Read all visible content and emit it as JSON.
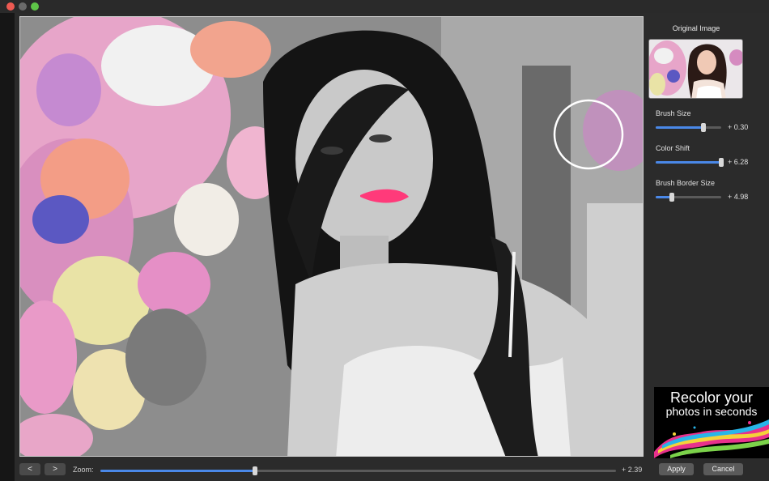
{
  "window": {
    "traffic_lights": [
      "close",
      "minimize",
      "zoom"
    ],
    "colors": {
      "close": "#ee5a52",
      "minimize": "#6b6b6b",
      "zoom": "#5ec548"
    }
  },
  "canvas": {
    "image_description_icon": "photo-canvas",
    "brush_cursor_icon": "circle-brush-cursor"
  },
  "panel": {
    "title": "Original Image",
    "sliders": [
      {
        "label": "Brush Size",
        "value": "+ 0.30",
        "level": 0.73
      },
      {
        "label": "Color Shift",
        "value": "+ 6.28",
        "level": 1.0
      },
      {
        "label": "Brush Border Size",
        "value": "+ 4.98",
        "level": 0.25
      }
    ]
  },
  "bottom": {
    "prev_label": "<",
    "next_label": ">",
    "zoom_label": "Zoom:",
    "zoom_value": "+ 2.39",
    "zoom_level": 0.3,
    "apply_label": "Apply",
    "cancel_label": "Cancel"
  },
  "promo": {
    "line1": "Recolor your",
    "line2": "photos in seconds"
  },
  "accent_color": "#4a88e8"
}
